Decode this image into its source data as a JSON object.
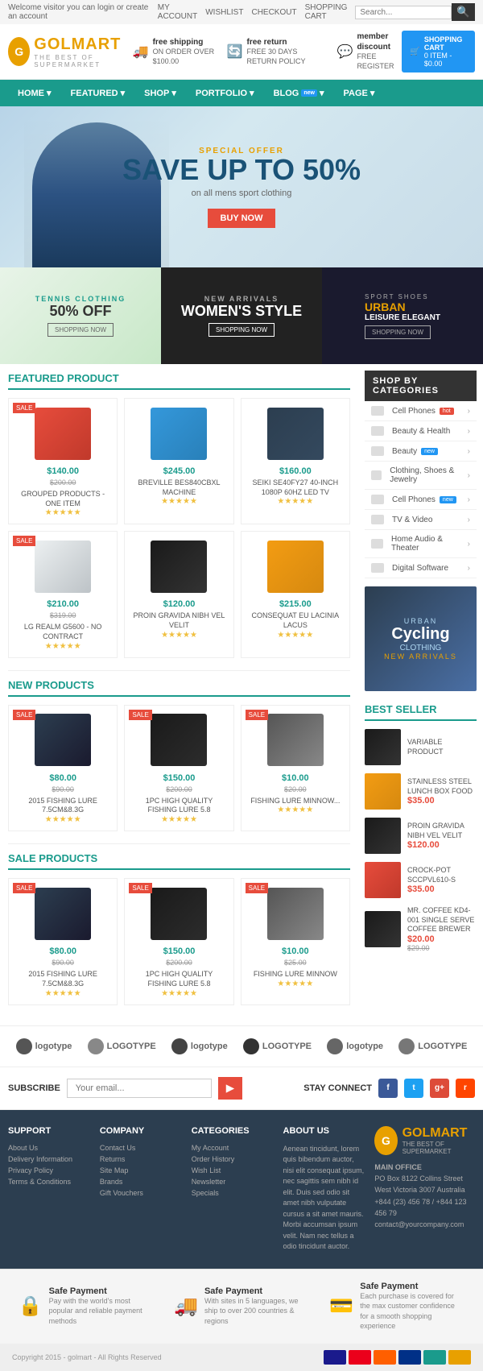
{
  "topbar": {
    "welcome": "Welcome visitor you can login or create an account",
    "myaccount": "MY ACCOUNT",
    "wishlist": "WISHLIST",
    "checkout": "CHECKOUT",
    "shoppingcart": "SHOPPING CART",
    "search_placeholder": "Search..."
  },
  "header": {
    "logo_letter": "G",
    "logo_name": "GOLMART",
    "logo_tagline": "THE BEST OF SUPERMARKET",
    "benefit1_title": "free shipping",
    "benefit1_sub": "ON ORDER OVER $100.00",
    "benefit2_title": "free return",
    "benefit2_sub": "FREE 30 DAYS RETURN POLICY",
    "benefit3_title": "member discount",
    "benefit3_sub": "FREE REGISTER",
    "cart_label": "SHOPPING CART",
    "cart_items": "0 ITEM",
    "cart_total": "$0.00"
  },
  "nav": {
    "items": [
      {
        "label": "HOME",
        "badge": ""
      },
      {
        "label": "FEATURED",
        "badge": ""
      },
      {
        "label": "SHOP",
        "badge": ""
      },
      {
        "label": "PORTFOLIO",
        "badge": ""
      },
      {
        "label": "BLOG",
        "badge": "new"
      },
      {
        "label": "PAGE",
        "badge": ""
      }
    ]
  },
  "hero": {
    "special": "SPECIAL OFFER",
    "title": "SAVE UP TO 50%",
    "subtitle": "on all mens sport clothing",
    "btn": "BUY NOW"
  },
  "sub_banners": [
    {
      "label": "TENNIS CLOTHING",
      "title": "50% OFF",
      "btn": "SHOPPING NOW"
    },
    {
      "label": "NEW ARRIVALS",
      "title": "WOMEN'S STYLE",
      "btn": "SHOPPING NOW"
    },
    {
      "sport_label": "SPORT SHOES",
      "sport_title": "URBAN",
      "sport_sub": "LEISURE ELEGANT",
      "btn": "SHOPPING NOW"
    }
  ],
  "featured": {
    "title": "FEATURED PRODUCT",
    "products": [
      {
        "name": "GROUPED PRODUCTS - ONE ITEM",
        "price": "$140.00",
        "old_price": "$200.00",
        "sale": true,
        "type": "oven"
      },
      {
        "name": "BREVILLE BES840CBXL MACHINE",
        "price": "$245.00",
        "old_price": "",
        "sale": false,
        "type": "monitor"
      },
      {
        "name": "SEIKI SE40FY27 40-INCH 1080P 60HZ LED TV",
        "price": "$160.00",
        "old_price": "",
        "sale": false,
        "type": "tablet"
      },
      {
        "name": "LG REALM G5600 - NO CONTRACT",
        "price": "$210.00",
        "old_price": "$319.00",
        "sale": true,
        "type": "gamepad"
      },
      {
        "name": "PROIN GRAVIDA NIBH VEL VELIT",
        "price": "$120.00",
        "old_price": "",
        "sale": false,
        "type": "bag"
      },
      {
        "name": "CONSEQUAT EU LACINIA LACUS",
        "price": "$215.00",
        "old_price": "",
        "sale": false,
        "type": "jar"
      }
    ]
  },
  "shop_categories": {
    "title": "SHOP BY CATEGORIES",
    "items": [
      {
        "name": "Cell Phones",
        "badge": "hot",
        "badge_type": "red"
      },
      {
        "name": "Beauty & Health",
        "badge": "",
        "badge_type": ""
      },
      {
        "name": "Beauty",
        "badge": "new",
        "badge_type": "blue"
      },
      {
        "name": "Clothing, Shoes & Jewelry",
        "badge": "",
        "badge_type": ""
      },
      {
        "name": "Cell Phones",
        "badge": "new",
        "badge_type": "blue"
      },
      {
        "name": "TV & Video",
        "badge": "",
        "badge_type": ""
      },
      {
        "name": "Home Audio & Theater",
        "badge": "",
        "badge_type": ""
      },
      {
        "name": "Digital Software",
        "badge": "",
        "badge_type": ""
      }
    ]
  },
  "cycling_banner": {
    "label": "Cycling",
    "title": "Cycling",
    "sub": "CLOTHING",
    "new": "NEW ARRIVALS"
  },
  "new_products": {
    "title": "NEW PRODUCTS",
    "products": [
      {
        "name": "2015 FISHING LURE 7.5CM&8.3G",
        "price": "$80.00",
        "old_price": "$90.00",
        "sale": true,
        "type": "fishing"
      },
      {
        "name": "1PC HIGH QUALITY FISHING LURE 5.8",
        "price": "$150.00",
        "old_price": "$200.00",
        "sale": true,
        "type": "headphones"
      },
      {
        "name": "FISHING LURE MINNOW...",
        "price": "$10.00",
        "old_price": "$20.00",
        "sale": true,
        "type": "headphones2"
      }
    ]
  },
  "best_seller": {
    "title": "BEST SELLER",
    "items": [
      {
        "name": "VARIABLE PRODUCT",
        "price": "",
        "old_price": "",
        "type": "bag"
      },
      {
        "name": "STAINLESS STEEL LUNCH BOX FOOD",
        "price": "$35.00",
        "old_price": "",
        "type": "jar"
      },
      {
        "name": "PROIN GRAVIDA NIBH VEL VELIT",
        "price": "$120.00",
        "old_price": "",
        "type": "bag"
      },
      {
        "name": "CROCK-POT SCCPVL610-S",
        "price": "$35.00",
        "old_price": "",
        "type": "oven"
      },
      {
        "name": "MR. COFFEE KD4-001 SINGLE SERVE COFFEE BREWER",
        "price": "$20.00",
        "old_price": "$29.00",
        "type": "bag"
      }
    ]
  },
  "sale_products": {
    "title": "SALE PRODUCTS",
    "products": [
      {
        "name": "2015 FISHING LURE 7.5CM&8.3G",
        "price": "$80.00",
        "old_price": "$90.00",
        "sale": true,
        "type": "fishing"
      },
      {
        "name": "1PC HIGH QUALITY FISHING LURE 5.8",
        "price": "$150.00",
        "old_price": "$200.00",
        "sale": true,
        "type": "headphones"
      },
      {
        "name": "FISHING LURE MINNOW",
        "price": "$10.00",
        "old_price": "$25.00",
        "sale": true,
        "type": "headphones2"
      }
    ]
  },
  "brands": [
    "logotype",
    "LOGOTYPE",
    "logotype",
    "LOGOTYPE",
    "logotype",
    "LOGOTYPE"
  ],
  "subscribe": {
    "label": "SUBSCRIBE",
    "placeholder": "Your email...",
    "btn": "▶",
    "stay_connect": "STAY CONNECT"
  },
  "footer": {
    "support_title": "SUPPORT",
    "support_links": [
      "About Us",
      "Delivery Information",
      "Privacy Policy",
      "Terms & Conditions"
    ],
    "company_title": "COMPANY",
    "company_links": [
      "Contact Us",
      "Returns",
      "Site Map",
      "Brands",
      "Gift Vouchers"
    ],
    "categories_title": "CATEGORIES",
    "categories_links": [
      "My Account",
      "Order History",
      "Wish List",
      "Newsletter",
      "Specials"
    ],
    "aboutus_title": "ABOUT US",
    "aboutus_text": "Aenean tincidunt, lorem quis bibendum auctor, nisi elit consequat ipsum, nec sagittis sem nibh id elit. Duis sed odio sit amet nibh vulputate cursus a sit amet mauris. Morbi accumsan ipsum velit. Nam nec tellus a odio tincidunt auctor.",
    "brand_title": "GOLMART",
    "brand_sub": "THE BEST OF SUPERMARKET",
    "main_office": "MAIN OFFICE",
    "address": "PO Box 8122 Collins Street West Victoria 3007 Australia",
    "phone1": "+844 (23) 456 78 / +844 123 456 79",
    "email": "contact@yourcompany.com"
  },
  "bottom_features": [
    {
      "title": "Safe Payment",
      "desc": "Pay with the world's most popular and reliable payment methods"
    },
    {
      "title": "Safe Payment",
      "desc": "With sites in 5 languages, we ship to over 200 countries & regions"
    },
    {
      "title": "Safe Payment",
      "desc": "Each purchase is covered for the max customer confidence for a smooth shopping experience"
    }
  ],
  "copyright": "Copyright 2015 - golmart - All Rights Reserved",
  "colors": {
    "teal": "#1a9b8c",
    "orange": "#e8a000",
    "red": "#e74c3c",
    "dark": "#2c3e50"
  }
}
